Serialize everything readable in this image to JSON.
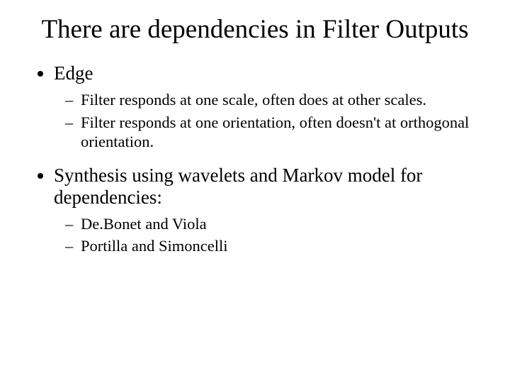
{
  "title": "There are dependencies in Filter Outputs",
  "bullets": {
    "b1": {
      "text": "Edge",
      "sub": {
        "s1": "Filter responds at one scale, often does at other scales.",
        "s2": "Filter responds at one orientation, often doesn't at orthogonal orientation."
      }
    },
    "b2": {
      "text": "Synthesis using wavelets and Markov model for dependencies:",
      "sub": {
        "s1": "De.Bonet and Viola",
        "s2": "Portilla and Simoncelli"
      }
    }
  }
}
